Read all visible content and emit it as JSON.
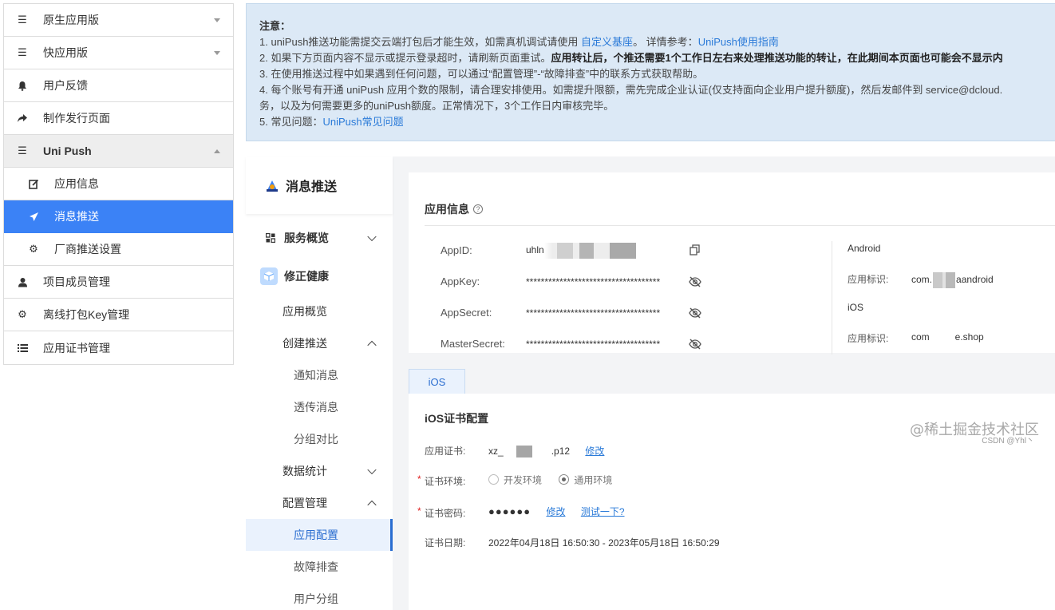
{
  "left_menu": {
    "items": [
      {
        "label": "原生应用版",
        "icon": "list-icon",
        "caret": "down"
      },
      {
        "label": "快应用版",
        "icon": "list-icon",
        "caret": "down"
      },
      {
        "label": "用户反馈",
        "icon": "bell-icon"
      },
      {
        "label": "制作发行页面",
        "icon": "share-arrow-icon"
      },
      {
        "label": "Uni Push",
        "icon": "list-icon",
        "caret": "up"
      },
      {
        "label": "应用信息",
        "icon": "edit-icon"
      },
      {
        "label": "消息推送",
        "icon": "send-icon"
      },
      {
        "label": "厂商推送设置",
        "icon": "gear-icon"
      },
      {
        "label": "项目成员管理",
        "icon": "user-icon"
      },
      {
        "label": "离线打包Key管理",
        "icon": "gear-icon"
      },
      {
        "label": "应用证书管理",
        "icon": "list-detail-icon"
      }
    ]
  },
  "notice": {
    "title": "注意：",
    "line1_a": "1. uniPush推送功能需提交云端打包后才能生效，如需真机调试请使用 ",
    "line1_link1": "自定义基座",
    "line1_b": "。 详情参考：",
    "line1_link2": "UniPush使用指南",
    "line2_a": "2. 如果下方页面内容不显示或提示登录超时，请刷新页面重试。",
    "line2_b": "应用转让后，个推还需要1个工作日左右来处理推送功能的转让，在此期间本页面也可能会不显示内",
    "line3": "3. 在使用推送过程中如果遇到任何问题，可以通过“配置管理”-“故障排查”中的联系方式获取帮助。",
    "line4a": "4. 每个账号有开通 uniPush 应用个数的限制，请合理安排使用。如需提升限额，需先完成企业认证(仅支持面向企业用户提升额度)，然后发邮件到 service@dcloud.",
    "line4b": "务，以及为何需要更多的uniPush额度。正常情况下，3个工作日内审核完毕。",
    "line5_a": "5. 常见问题：",
    "line5_link": "UniPush常见问题"
  },
  "inner_side": {
    "header": "消息推送",
    "service_overview": "服务概览",
    "fix_health": "修正健康",
    "app_overview": "应用概览",
    "create_push": "创建推送",
    "notify_msg": "通知消息",
    "passthrough_msg": "透传消息",
    "group_compare": "分组对比",
    "data_stats": "数据统计",
    "config_mgmt": "配置管理",
    "app_config": "应用配置",
    "troubleshoot": "故障排查",
    "user_group": "用户分组"
  },
  "app_info": {
    "title": "应用信息",
    "help": "?",
    "appid_label": "AppID:",
    "appid_value": "uhln",
    "appkey_label": "AppKey:",
    "appkey_value": "************************************",
    "appsecret_label": "AppSecret:",
    "appsecret_value": "************************************",
    "mastersecret_label": "MasterSecret:",
    "mastersecret_value": "************************************",
    "android": "Android",
    "android_id_label": "应用标识:",
    "android_id_a": "com.",
    "android_id_b": "a",
    "android_id_c": "android",
    "ios": "iOS",
    "ios_id_label": "应用标识:",
    "ios_id_a": "com",
    "ios_id_b": "e.shop"
  },
  "ios_panel": {
    "tab": "iOS",
    "title": "iOS证书配置",
    "cert_label": "应用证书:",
    "cert_a": "xz_",
    "cert_b": ".p12",
    "cert_edit": "修改",
    "env_label": "证书环境:",
    "env_dev": "开发环境",
    "env_general": "通用环境",
    "env_selected": "通用环境",
    "pwd_label": "证书密码:",
    "pwd_value": "●●●●●●",
    "pwd_edit": "修改",
    "pwd_test": "测试一下?",
    "date_label": "证书日期:",
    "date_value": "2022年04月18日 16:50:30 - 2023年05月18日 16:50:29"
  },
  "watermark": {
    "main": "@稀土掘金技术社区",
    "sub": "CSDN @Yhl丶"
  }
}
